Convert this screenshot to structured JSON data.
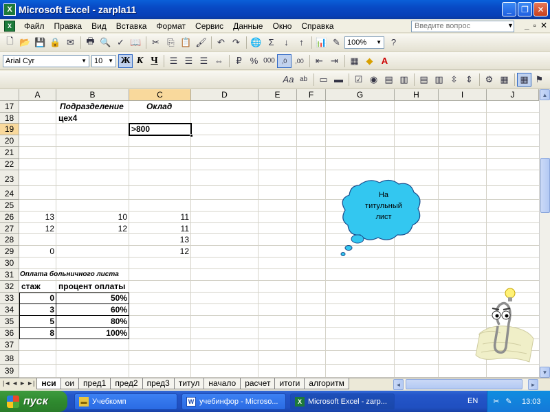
{
  "window": {
    "title": "Microsoft Excel - zarpla11"
  },
  "menu": {
    "items": [
      "Файл",
      "Правка",
      "Вид",
      "Вставка",
      "Формат",
      "Сервис",
      "Данные",
      "Окно",
      "Справка"
    ],
    "help_placeholder": "Введите вопрос"
  },
  "toolbar": {
    "zoom": "100%",
    "font_name": "Arial Cyr",
    "font_size": "10",
    "bold": "Ж",
    "italic": "К",
    "underline": "Ч"
  },
  "columns": [
    "A",
    "B",
    "C",
    "D",
    "E",
    "F",
    "G",
    "H",
    "I",
    "J"
  ],
  "selected_column": "C",
  "rows": [
    "17",
    "18",
    "19",
    "20",
    "21",
    "22",
    "23",
    "24",
    "25",
    "26",
    "27",
    "28",
    "29",
    "30",
    "31",
    "32",
    "33",
    "34",
    "35",
    "36",
    "37",
    "38",
    "39"
  ],
  "selected_row": "19",
  "cells": {
    "b17": "Подразделение",
    "c17": "Оклад",
    "b18": "цех4",
    "c19": ">800",
    "a26": "13",
    "b26": "10",
    "c26": "11",
    "a27": "12",
    "b27": "12",
    "c27": "11",
    "c28": "13",
    "a29": "0",
    "c29": "12",
    "a31": "Оплата больничного листа",
    "a32": "стаж",
    "b32": "процент оплаты",
    "a33": "0",
    "b33": "50%",
    "a34": "3",
    "b34": "60%",
    "a35": "5",
    "b35": "80%",
    "a36": "8",
    "b36": "100%"
  },
  "callout": {
    "line1": "На",
    "line2": "титульный",
    "line3": "лист"
  },
  "sheet_tabs": [
    "нси",
    "ои",
    "пред1",
    "пред2",
    "пред3",
    "титул",
    "начало",
    "расчет",
    "итоги",
    "алгоритм"
  ],
  "active_sheet": "нси",
  "taskbar": {
    "start": "пуск",
    "buttons": [
      "Учебкомп",
      "учебинфор - Microso...",
      "Microsoft Excel - zarp..."
    ],
    "language": "EN",
    "clock": "13:03"
  },
  "colors": {
    "selection_header": "#f9d99c",
    "callout_fill": "#33c7f0",
    "title_bar": "#0849c4"
  }
}
